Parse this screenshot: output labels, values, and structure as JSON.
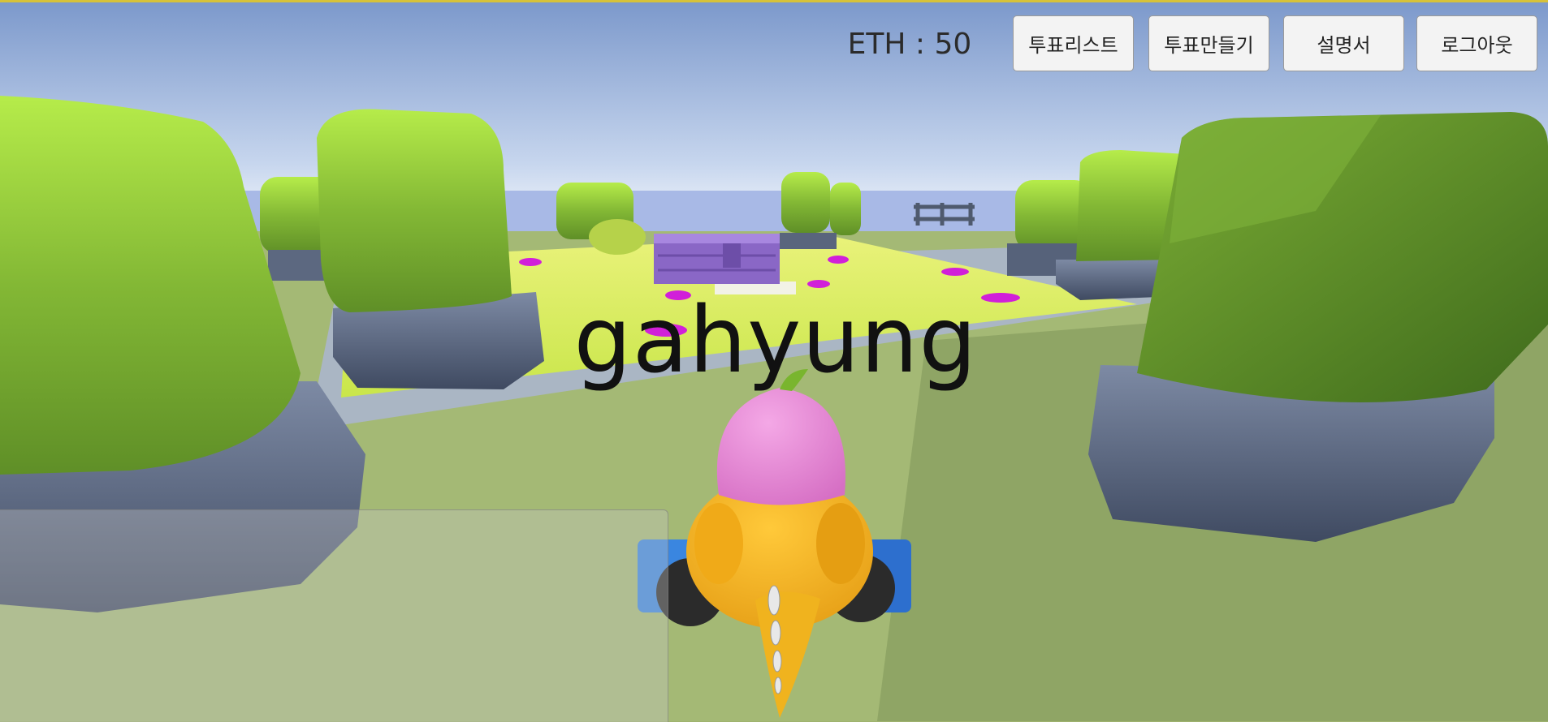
{
  "hud": {
    "eth_label": "ETH : 50",
    "buttons": [
      {
        "label": "투표리스트"
      },
      {
        "label": "투표만들기"
      },
      {
        "label": "설명서"
      },
      {
        "label": "로그아웃"
      }
    ]
  },
  "player": {
    "name": "gahyung"
  },
  "colors": {
    "sky_top": "#7d9cd0",
    "sky_horizon": "#e7eef7",
    "ground": "#9fb36e",
    "bush": "#8dc23d",
    "planter": "#5d6a82",
    "arena": "#d7ec55",
    "marker": "#d21fd9",
    "character_body": "#f4b21f",
    "character_hat": "#e98ad6"
  }
}
